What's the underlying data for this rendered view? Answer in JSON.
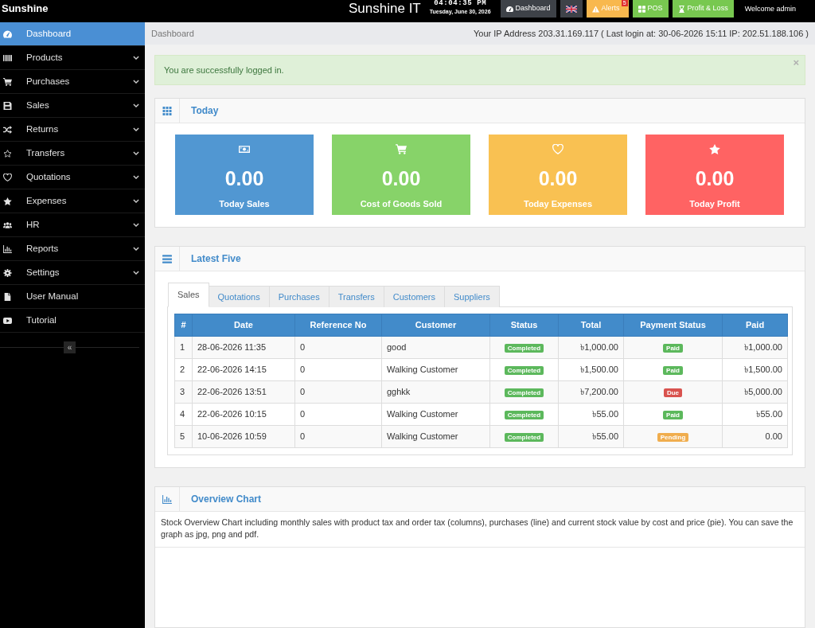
{
  "top_bar": {
    "brand": "Sunshine",
    "title": "Sunshine IT",
    "clock": {
      "time": "04:04:35 PM",
      "date": "Tuesday, June 30, 2026"
    },
    "buttons": [
      {
        "kind": "dashboard",
        "label": "Dashboard",
        "color": "#3e4248"
      },
      {
        "kind": "language",
        "color": "#3e4248"
      },
      {
        "kind": "alerts",
        "label": "Alerts",
        "badge": "5",
        "color": "#f8b84e"
      },
      {
        "kind": "pos",
        "label": "POS",
        "color": "#78c850"
      },
      {
        "kind": "profit_loss",
        "label": "Profit & Loss",
        "color": "#78c850"
      }
    ],
    "welcome": "Welcome admin"
  },
  "sidebar": {
    "items": [
      {
        "kind": "dashboard",
        "label": "Dashboard",
        "selected": true,
        "has_submenu": false
      },
      {
        "kind": "products",
        "label": "Products",
        "selected": false,
        "has_submenu": true
      },
      {
        "kind": "purchases",
        "label": "Purchases",
        "selected": false,
        "has_submenu": true
      },
      {
        "kind": "sales",
        "label": "Sales",
        "selected": false,
        "has_submenu": true
      },
      {
        "kind": "returns",
        "label": "Returns",
        "selected": false,
        "has_submenu": true
      },
      {
        "kind": "transfers",
        "label": "Transfers",
        "selected": false,
        "has_submenu": true
      },
      {
        "kind": "quotations",
        "label": "Quotations",
        "selected": false,
        "has_submenu": true
      },
      {
        "kind": "expenses",
        "label": "Expenses",
        "selected": false,
        "has_submenu": true
      },
      {
        "kind": "hr",
        "label": "HR",
        "selected": false,
        "has_submenu": true
      },
      {
        "kind": "reports",
        "label": "Reports",
        "selected": false,
        "has_submenu": true
      },
      {
        "kind": "settings",
        "label": "Settings",
        "selected": false,
        "has_submenu": true
      },
      {
        "kind": "manual",
        "label": "User Manual",
        "selected": false,
        "has_submenu": false
      },
      {
        "kind": "tutorial",
        "label": "Tutorial",
        "selected": false,
        "has_submenu": false
      }
    ],
    "collapse_button": "«"
  },
  "breadcrumb": "Dashboard",
  "login_info": "Your IP Address 203.31.169.117 ( Last login at: 30-06-2026 15:11 IP: 202.51.188.106 )",
  "alert": {
    "message": "You are successfully logged in.",
    "close": "×"
  },
  "today": {
    "title": "Today",
    "cards": [
      {
        "kind": "sales",
        "value": "0.00",
        "label": "Today Sales",
        "color": "#5197d2"
      },
      {
        "kind": "cost",
        "value": "0.00",
        "label": "Cost of Goods Sold",
        "color": "#87d369"
      },
      {
        "kind": "expenses",
        "value": "0.00",
        "label": "Today Expenses",
        "color": "#f9c152"
      },
      {
        "kind": "profit",
        "value": "0.00",
        "label": "Today Profit",
        "color": "#ff6363"
      }
    ]
  },
  "latest_five": {
    "title": "Latest Five",
    "tabs": [
      {
        "label": "Sales",
        "selected": true
      },
      {
        "label": "Quotations",
        "selected": false
      },
      {
        "label": "Purchases",
        "selected": false
      },
      {
        "label": "Transfers",
        "selected": false
      },
      {
        "label": "Customers",
        "selected": false
      },
      {
        "label": "Suppliers",
        "selected": false
      }
    ],
    "table": {
      "columns": [
        "#",
        "Date",
        "Reference No",
        "Customer",
        "Status",
        "Total",
        "Payment Status",
        "Paid"
      ],
      "rows": [
        {
          "number": "1",
          "date": "28-06-2026 11:35",
          "reference_no": "0",
          "customer": "good",
          "status": {
            "label": "Completed",
            "color": "#5cb85c"
          },
          "total": "৳1,000.00",
          "payment_status": {
            "label": "Paid",
            "color": "#5cb85c"
          },
          "paid": "৳1,000.00"
        },
        {
          "number": "2",
          "date": "22-06-2026 14:15",
          "reference_no": "0",
          "customer": "Walking Customer",
          "status": {
            "label": "Completed",
            "color": "#5cb85c"
          },
          "total": "৳1,500.00",
          "payment_status": {
            "label": "Paid",
            "color": "#5cb85c"
          },
          "paid": "৳1,500.00"
        },
        {
          "number": "3",
          "date": "22-06-2026 13:51",
          "reference_no": "0",
          "customer": "gghkk",
          "status": {
            "label": "Completed",
            "color": "#5cb85c"
          },
          "total": "৳7,200.00",
          "payment_status": {
            "label": "Due",
            "color": "#d9534f"
          },
          "paid": "৳5,000.00"
        },
        {
          "number": "4",
          "date": "22-06-2026 10:15",
          "reference_no": "0",
          "customer": "Walking Customer",
          "status": {
            "label": "Completed",
            "color": "#5cb85c"
          },
          "total": "৳55.00",
          "payment_status": {
            "label": "Paid",
            "color": "#5cb85c"
          },
          "paid": "৳55.00"
        },
        {
          "number": "5",
          "date": "10-06-2026 10:59",
          "reference_no": "0",
          "customer": "Walking Customer",
          "status": {
            "label": "Completed",
            "color": "#5cb85c"
          },
          "total": "৳55.00",
          "payment_status": {
            "label": "Pending",
            "color": "#f0ad4e"
          },
          "paid": "0.00"
        }
      ]
    }
  },
  "overview_chart": {
    "title": "Overview Chart",
    "description": "Stock Overview Chart including monthly sales with product tax and order tax (columns), purchases (line) and current stock value by cost and price (pie). You can save the graph as jpg, png and pdf."
  }
}
